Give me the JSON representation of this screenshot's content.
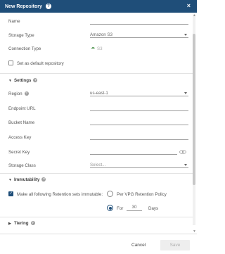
{
  "dialog": {
    "title": "New Repository",
    "close_icon": "close-icon",
    "help_icon": "help-icon"
  },
  "fields": {
    "name_label": "Name",
    "storage_type_label": "Storage Type",
    "storage_type_value": "Amazon S3",
    "connection_type_label": "Connection Type",
    "connection_type_value": "S3",
    "default_repo_label": "Set as default repository",
    "default_repo_checked": false
  },
  "settings": {
    "section_label": "Settings",
    "region_label": "Region",
    "region_value": "us-east-1",
    "endpoint_label": "Endpoint URL",
    "bucket_label": "Bucket Name",
    "access_key_label": "Access Key",
    "secret_key_label": "Secret Key",
    "storage_class_label": "Storage Class",
    "storage_class_placeholder": "Select..."
  },
  "immutability": {
    "section_label": "Immutability",
    "make_immutable_label": "Make all following Retention sets immutable:",
    "make_immutable_checked": true,
    "per_policy_label": "Per VPG Retention Policy",
    "for_label": "For",
    "days_value": "30",
    "days_label": "Days"
  },
  "tiering": {
    "section_label": "Tiering"
  },
  "footer": {
    "cancel_label": "Cancel",
    "save_label": "Save"
  },
  "colors": {
    "titlebar": "#1f4e79",
    "accent": "#1f4e79"
  }
}
